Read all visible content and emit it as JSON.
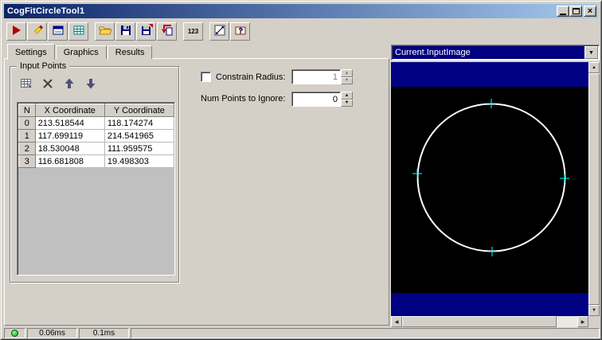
{
  "window": {
    "title": "CogFitCircleTool1"
  },
  "toolbar": {
    "icons": [
      "run",
      "electric-pencil",
      "floating-graphics",
      "image-display-grid",
      "open-file",
      "save-file",
      "save-results",
      "import-tool",
      "numeric-precision",
      "results-graph",
      "help"
    ],
    "numeric_label": "123"
  },
  "tabs": [
    {
      "label": "Settings",
      "active": true
    },
    {
      "label": "Graphics",
      "active": false
    },
    {
      "label": "Results",
      "active": false
    }
  ],
  "input_points": {
    "group_label": "Input Points",
    "toolbar_icons": [
      "point-grid",
      "delete-point",
      "move-point-up",
      "move-point-down"
    ],
    "table": {
      "columns": [
        "N",
        "X Coordinate",
        "Y Coordinate"
      ],
      "rows": [
        [
          "0",
          "213.518544",
          "118.174274"
        ],
        [
          "1",
          "117.699119",
          "214.541965"
        ],
        [
          "2",
          "18.530048",
          "111.959575"
        ],
        [
          "3",
          "116.681808",
          "19.498303"
        ]
      ]
    }
  },
  "settings": {
    "constrain_radius": {
      "label": "Constrain Radius:",
      "checked": false,
      "value": "1",
      "enabled": false
    },
    "num_points_to_ignore": {
      "label": "Num Points to Ignore:",
      "value": "0"
    }
  },
  "image_panel": {
    "source_selector": "Current.InputImage"
  },
  "status_bar": {
    "run_time": "0.06ms",
    "result_time": "0.1ms"
  },
  "colors": {
    "selection": "#000080",
    "image_background": "#000000",
    "image_band": "#000082",
    "circle": "#ffffff",
    "marker": "#00ffff",
    "status_led": "#00a800",
    "titlebar_left": "#0a246a",
    "titlebar_right": "#a6caf0"
  }
}
